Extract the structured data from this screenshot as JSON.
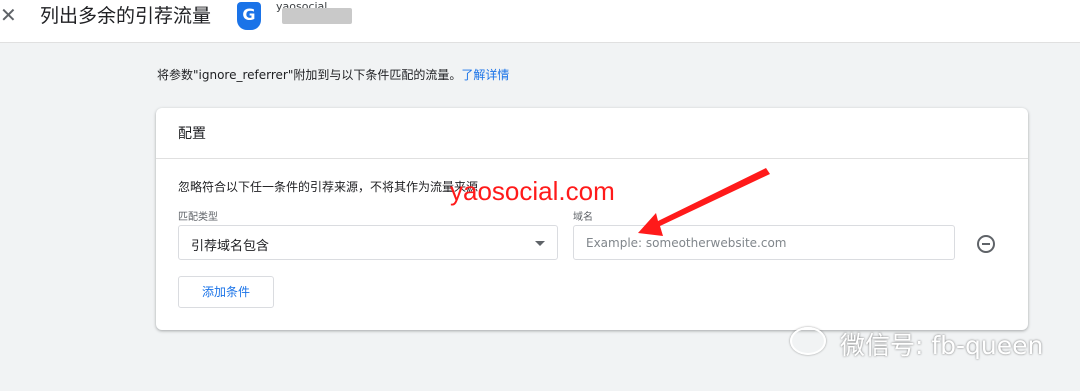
{
  "header": {
    "close_icon": "✕",
    "title": "列出多余的引荐流量",
    "analytics_icon": "G",
    "account_name": "yaosocial"
  },
  "intro": {
    "text": "将参数\"ignore_referrer\"附加到与以下条件匹配的流量。",
    "link_label": "了解详情"
  },
  "config": {
    "title": "配置",
    "description": "忽略符合以下任一条件的引荐来源，不将其作为流量来源",
    "match_type_label": "匹配类型",
    "match_type_value": "引荐域名包含",
    "domain_label": "域名",
    "domain_value": "",
    "domain_placeholder": "Example: someotherwebsite.com",
    "add_condition_label": "添加条件"
  },
  "annotations": {
    "watermark": "yaosocial.com",
    "arrow_color": "#ff1a1a"
  },
  "wechat": {
    "text": "微信号: fb-queen"
  },
  "colors": {
    "accent": "#1a73e8",
    "background": "#f1f3f4"
  }
}
